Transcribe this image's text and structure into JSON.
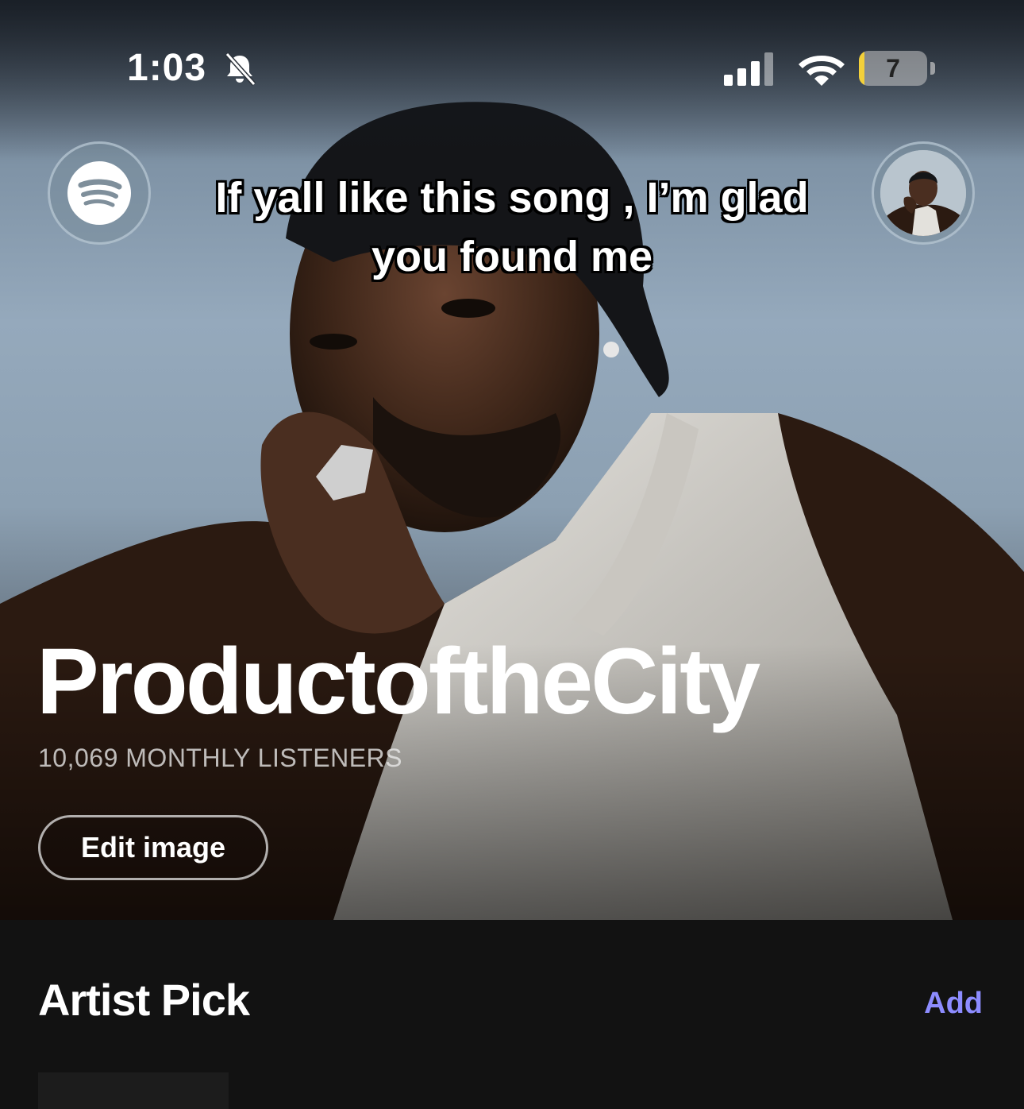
{
  "status_bar": {
    "time": "1:03",
    "battery_level": "7",
    "battery_fraction": 0.07,
    "icons": [
      "bell-slash-icon",
      "cellular-signal-icon",
      "wifi-icon",
      "battery-icon"
    ]
  },
  "header": {
    "left_button_icon": "spotify-logo-icon",
    "right_button_icon": "profile-avatar"
  },
  "caption": {
    "line1": "If yall like this song , I’m glad",
    "line2": "you found me"
  },
  "artist": {
    "name": "ProductoftheCity",
    "monthly_listeners": "10,069 MONTHLY LISTENERS",
    "edit_image_label": "Edit image"
  },
  "artist_pick": {
    "title": "Artist Pick",
    "add_label": "Add"
  },
  "colors": {
    "accent_link": "#8d8cff",
    "background": "#121212",
    "battery_low": "#f3d03a"
  }
}
